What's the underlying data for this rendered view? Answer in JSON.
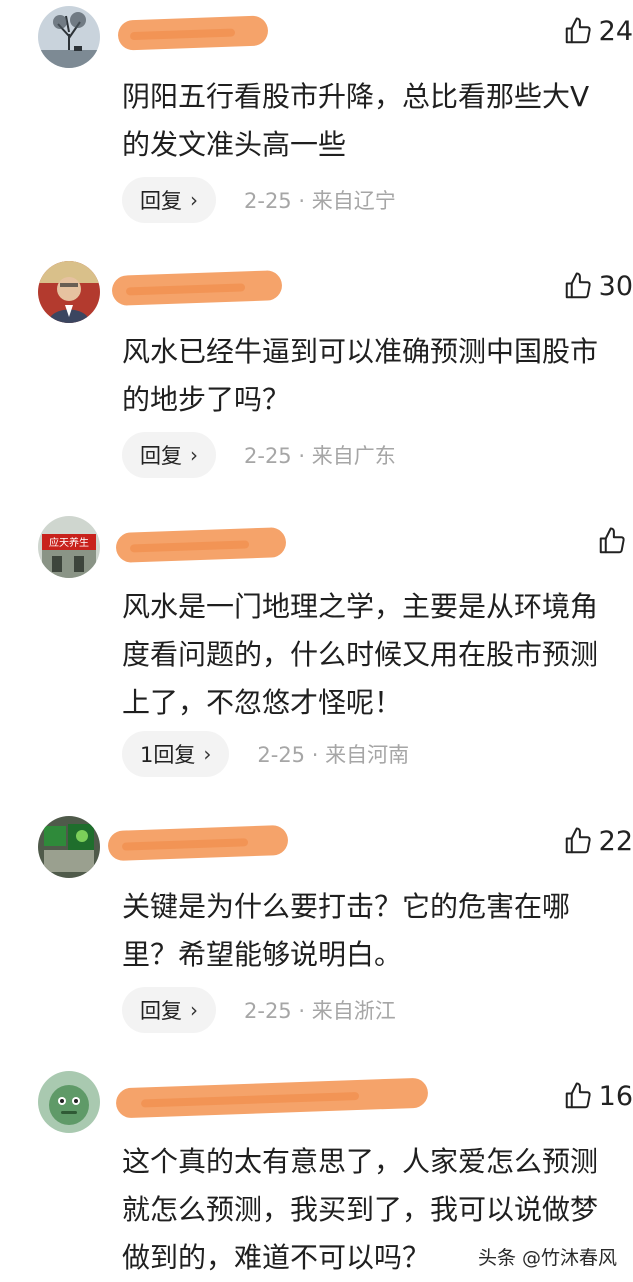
{
  "comments": [
    {
      "likes": "24",
      "text_lines": [
        "阴阳五行看股市升降，总比看那些大V",
        "的发文准头高一些"
      ],
      "reply_label": "回复",
      "date": "2-25",
      "location": "· 来自辽宁"
    },
    {
      "likes": "30",
      "text_lines": [
        "风水已经牛逼到可以准确预测中国股市",
        "的地步了吗？"
      ],
      "reply_label": "回复",
      "date": "2-25",
      "location": "· 来自广东"
    },
    {
      "likes": "",
      "avatar_sign": "应天养生",
      "text_lines": [
        "风水是一门地理之学，主要是从环境角",
        "度看问题的，什么时候又用在股市预测",
        "上了，不忽悠才怪呢！"
      ],
      "reply_label": "1回复",
      "date": "2-25",
      "location": "· 来自河南"
    },
    {
      "likes": "22",
      "text_lines": [
        "关键是为什么要打击？它的危害在哪",
        "里？希望能够说明白。"
      ],
      "reply_label": "回复",
      "date": "2-25",
      "location": "· 来自浙江"
    },
    {
      "likes": "16",
      "text_lines": [
        "这个真的太有意思了，人家爱怎么预测",
        "就怎么预测，我买到了，我可以说做梦",
        "做到的，难道不可以吗？"
      ]
    }
  ],
  "watermark": "头条 @竹沐春风",
  "icons": {
    "like": "thumbs-up-icon",
    "chevron": "chevron-right-icon"
  }
}
